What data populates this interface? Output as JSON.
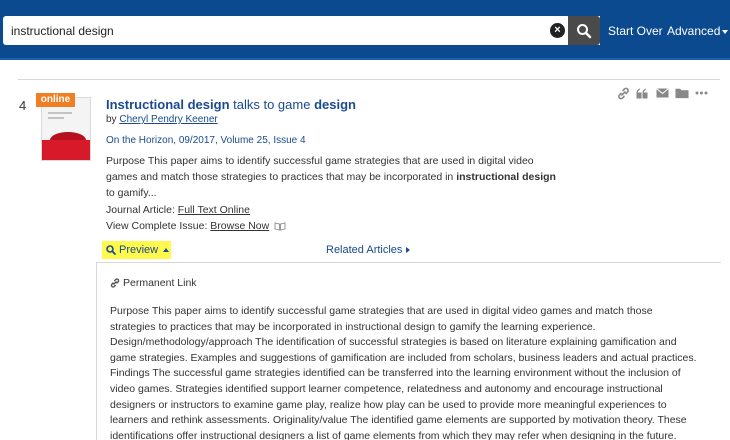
{
  "search": {
    "value": "instructional design",
    "clear_icon": "x-circle-icon",
    "search_icon": "magnifier-icon"
  },
  "nav": {
    "start_over": "Start Over",
    "advanced": "Advanced"
  },
  "colors": {
    "topbar": "#0c4a8f",
    "link": "#1a4a8f",
    "highlight": "#fff94d",
    "badge": "#f07f23"
  },
  "result": {
    "number": "4",
    "badge": "online",
    "title_parts": [
      "Instructional design",
      " talks to game ",
      "design"
    ],
    "by": "by",
    "author": "Cheryl Pendry Keener",
    "source": "On the Horizon, 09/2017, Volume 25, Issue 4",
    "abstract_short_a": "Purpose This paper aims to identify successful game strategies that are used in digital video games and match those strategies to practices that may be incorporated in ",
    "abstract_short_b": "instructional design",
    "abstract_short_c": " to gamify...",
    "format_label": "Journal Article:",
    "format_link": "Full Text Online",
    "issue_label": "View Complete Issue:",
    "issue_link": "Browse Now",
    "actions": [
      "link-icon",
      "quote-icon",
      "email-icon",
      "folder-icon",
      "more-icon"
    ]
  },
  "tabs": {
    "preview": "Preview",
    "related": "Related Articles"
  },
  "preview": {
    "permalink": "Permanent Link",
    "abstract": "Purpose This paper aims to identify successful game strategies that are used in digital video games and match those strategies to practices that may be incorporated in instructional design to gamify the learning experience. Design/methodology/approach The identification of successful strategies is based on literature explaining gamification and game strategies. Examples and suggestions of gamification are included from scholars, business leaders and actual practices. Findings The successful game strategies identified can be transferred into the learning environment without the inclusion of video games. Strategies identified support learner competence, relatedness and autonomy and encourage instructional designers or instructors to examine game play, realize how play can be used to provide more meaningful experiences to learners and rethink assessments. Originality/value The identified game elements are supported by motivation theory. These identifications offer instructional designers a list of game elements from which they may refer when designing in the future."
  }
}
